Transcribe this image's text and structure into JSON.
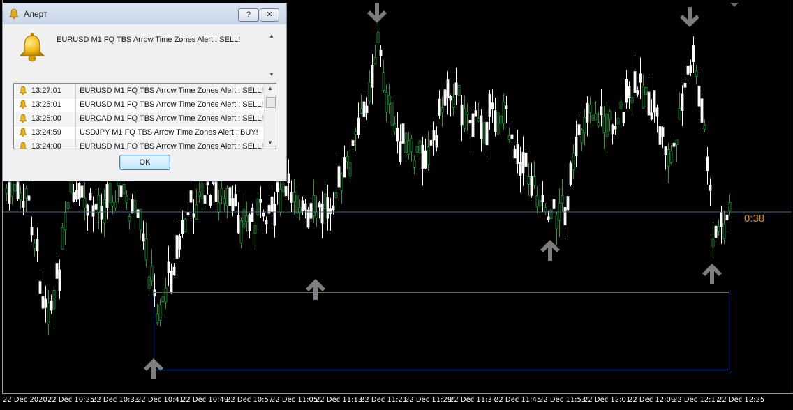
{
  "dialog": {
    "title": "Алерт",
    "help_label": "?",
    "close_label": "✕",
    "message": "EURUSD M1  FQ TBS Arrow Time Zones Alert : SELL!",
    "history": [
      {
        "time": "13:27:01",
        "text": "EURUSD M1  FQ TBS Arrow Time Zones Alert : SELL!"
      },
      {
        "time": "13:25:01",
        "text": "EURUSD M1  FQ TBS Arrow Time Zones Alert : SELL!"
      },
      {
        "time": "13:25:00",
        "text": "EURCAD M1  FQ TBS Arrow Time Zones Alert : SELL!"
      },
      {
        "time": "13:24:59",
        "text": "USDJPY M1  FQ TBS Arrow Time Zones Alert : BUY!"
      },
      {
        "time": "13:24:00",
        "text": "EURUSD M1  FQ TBS Arrow Time Zones Alert : SELL!"
      }
    ],
    "ok_label": "OK",
    "icon": "bell-icon"
  },
  "chart": {
    "price_timer": "0:38",
    "x_labels": [
      "22 Dec 2020",
      "22 Dec 10:25",
      "22 Dec 10:33",
      "22 Dec 10:41",
      "22 Dec 10:49",
      "22 Dec 10:57",
      "22 Dec 11:05",
      "22 Dec 11:13",
      "22 Dec 11:21",
      "22 Dec 11:29",
      "22 Dec 11:37",
      "22 Dec 11:45",
      "22 Dec 11:53",
      "22 Dec 12:01",
      "22 Dec 12:09",
      "22 Dec 12:17",
      "22 Dec 12:25"
    ],
    "colors": {
      "background": "#000000",
      "bull": "#1e9c3c",
      "bear": "#ffffff",
      "arrow": "#7d7d7d",
      "box": "#2f6ed0",
      "price_line": "#4a6e8c",
      "timer": "#d98c1f"
    },
    "arrow_icons": [
      "arrow-down-icon",
      "arrow-up-icon"
    ]
  }
}
